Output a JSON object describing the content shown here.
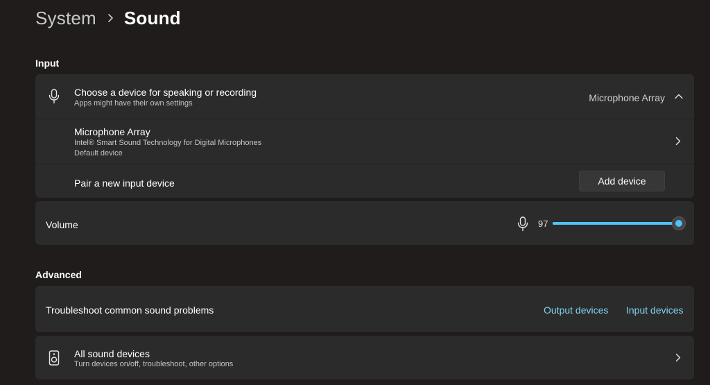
{
  "header": {
    "parent": "System",
    "current": "Sound"
  },
  "input_section": {
    "heading": "Input",
    "choose_device": {
      "title": "Choose a device for speaking or recording",
      "subtitle": "Apps might have their own settings",
      "selected_device": "Microphone Array",
      "icon": "microphone-icon",
      "expanded": true
    },
    "device": {
      "name": "Microphone Array",
      "description": "Intel® Smart Sound Technology for Digital Microphones",
      "status": "Default device"
    },
    "pair": {
      "label": "Pair a new input device",
      "button_label": "Add device"
    },
    "volume": {
      "label": "Volume",
      "value": "97",
      "level_percent": 97
    }
  },
  "advanced_section": {
    "heading": "Advanced",
    "troubleshoot": {
      "label": "Troubleshoot common sound problems",
      "output_link": "Output devices",
      "input_link": "Input devices"
    },
    "all_devices": {
      "title": "All sound devices",
      "subtitle": "Turn devices on/off, troubleshoot, other options",
      "icon": "speaker-icon"
    }
  },
  "colors": {
    "background": "#201c1b",
    "card": "#2b2b2b",
    "accent": "#4cc2ff",
    "link": "#7fd3f1"
  }
}
